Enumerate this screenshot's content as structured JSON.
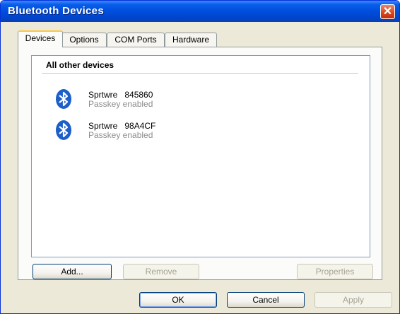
{
  "window": {
    "title": "Bluetooth Devices"
  },
  "tabs": [
    {
      "label": "Devices",
      "active": true
    },
    {
      "label": "Options",
      "active": false
    },
    {
      "label": "COM Ports",
      "active": false
    },
    {
      "label": "Hardware",
      "active": false
    }
  ],
  "list": {
    "group_header": "All other devices",
    "devices": [
      {
        "name": "Sprtwre",
        "address": "845860",
        "status": "Passkey enabled"
      },
      {
        "name": "Sprtwre",
        "address": "98A4CF",
        "status": "Passkey enabled"
      }
    ]
  },
  "panel_buttons": {
    "add": "Add...",
    "remove": "Remove",
    "properties": "Properties"
  },
  "dialog_buttons": {
    "ok": "OK",
    "cancel": "Cancel",
    "apply": "Apply"
  },
  "colors": {
    "titlebar": "#0050e0",
    "bluetooth": "#1c5fc8",
    "close": "#d9441c"
  }
}
